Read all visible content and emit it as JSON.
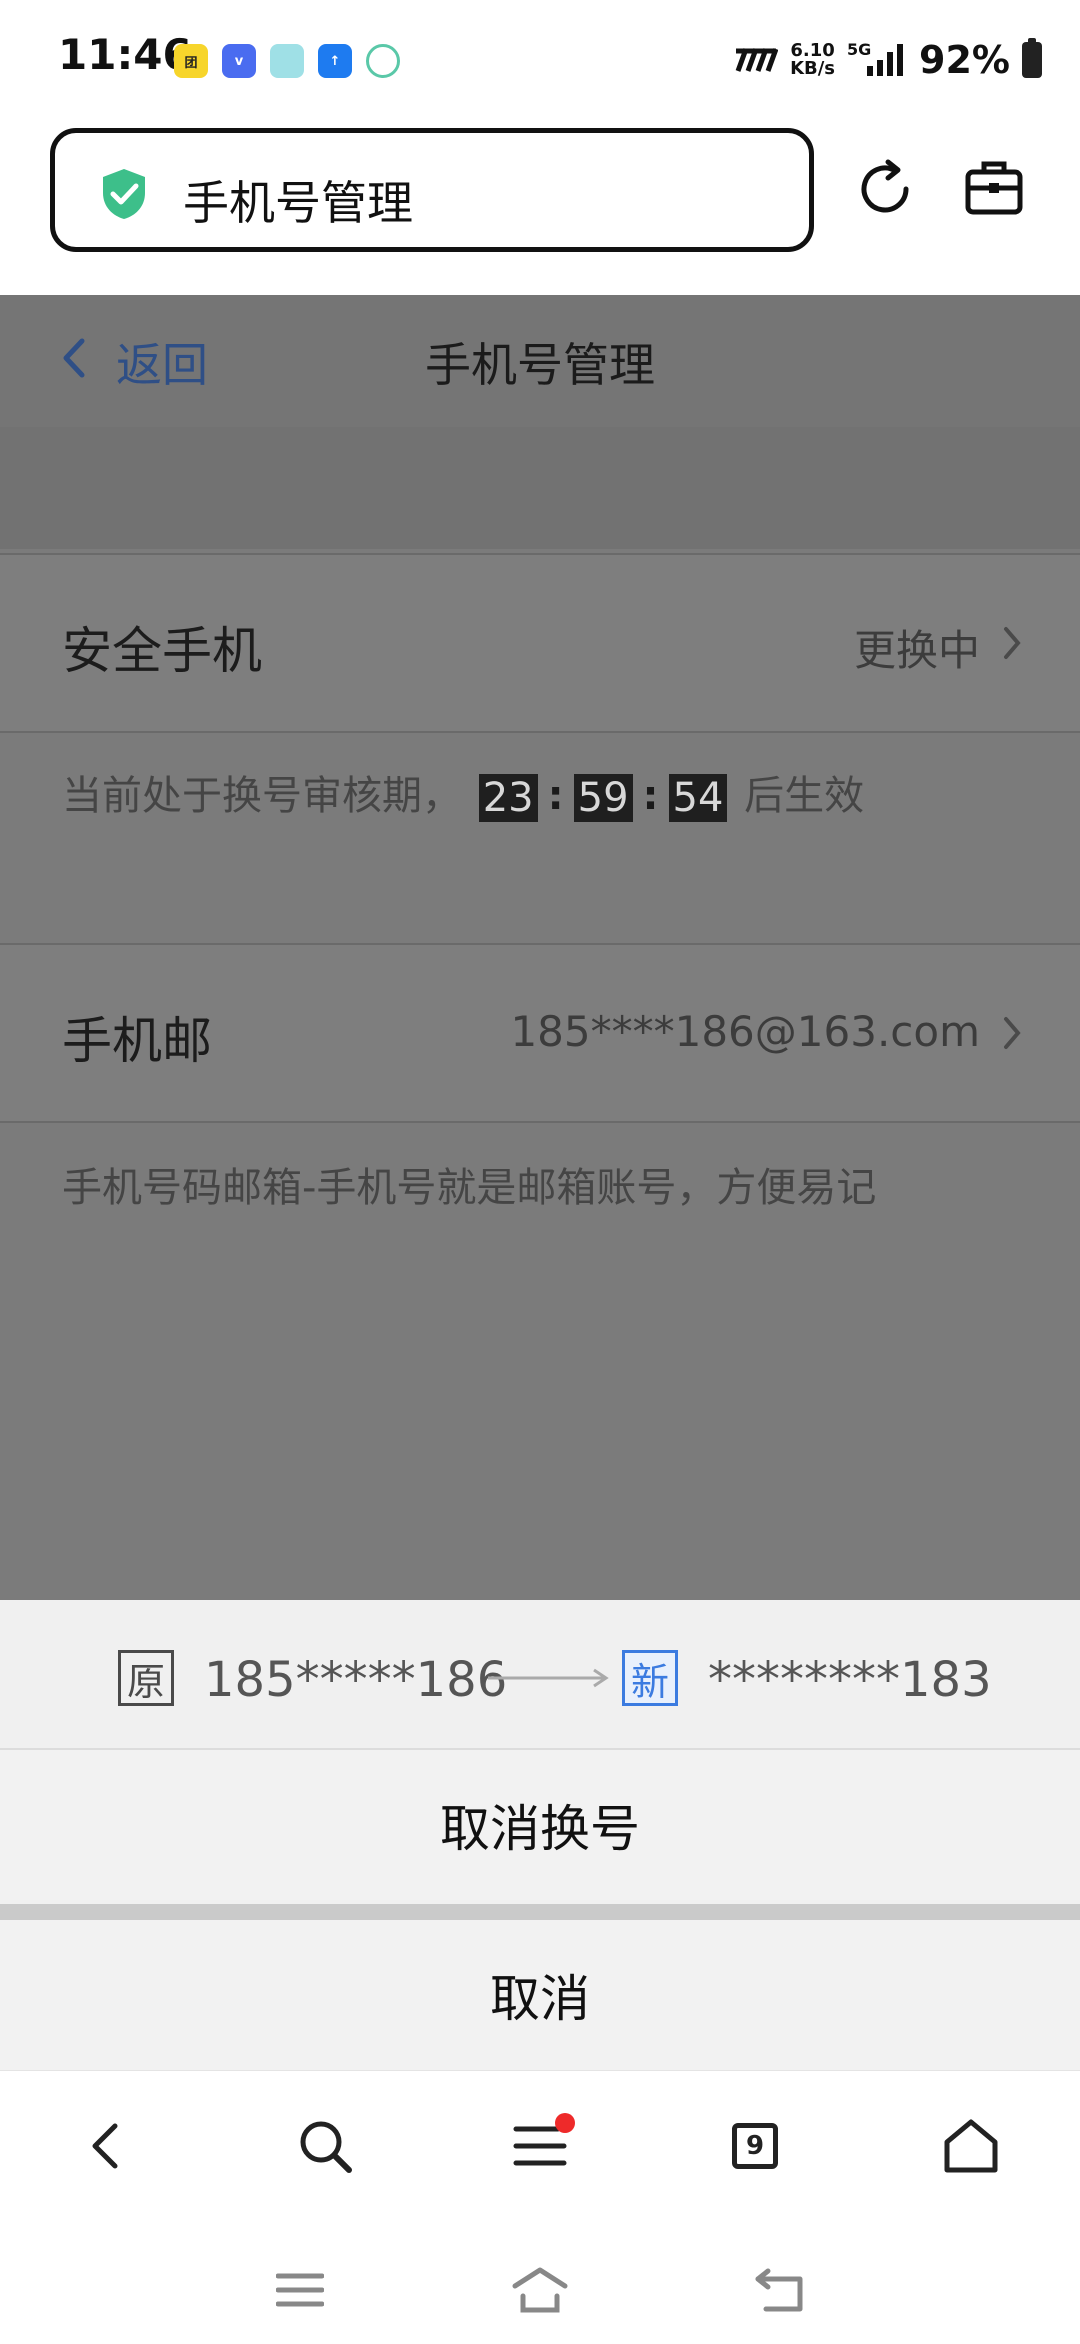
{
  "status_bar": {
    "time": "11:46",
    "net_speed_value": "6.10",
    "net_speed_unit": "KB/s",
    "network_type": "5G",
    "battery_percent": "92%"
  },
  "browser": {
    "url_title": "手机号管理",
    "tab_count": "9"
  },
  "page": {
    "back_label": "返回",
    "title": "手机号管理",
    "security_phone": {
      "label": "安全手机",
      "status": "更换中"
    },
    "review_hint": {
      "prefix": "当前处于换号审核期，",
      "hours": "23",
      "minutes": "59",
      "seconds": "54",
      "separator": ":",
      "suffix": "后生效"
    },
    "phone_mail": {
      "label": "手机邮",
      "value": "185****186@163.com"
    },
    "phone_mail_hint": "手机号码邮箱-手机号就是邮箱账号，方便易记"
  },
  "sheet": {
    "old_tag": "原",
    "old_number": "185*****186",
    "new_tag": "新",
    "new_number": "********183",
    "cancel_change_label": "取消换号",
    "cancel_label": "取消"
  },
  "colors": {
    "accent_blue": "#3b7be0",
    "shield_green": "#3dbf8a",
    "badge_red": "#ee2a2a",
    "overlay_gray": "#7b7b7b"
  }
}
